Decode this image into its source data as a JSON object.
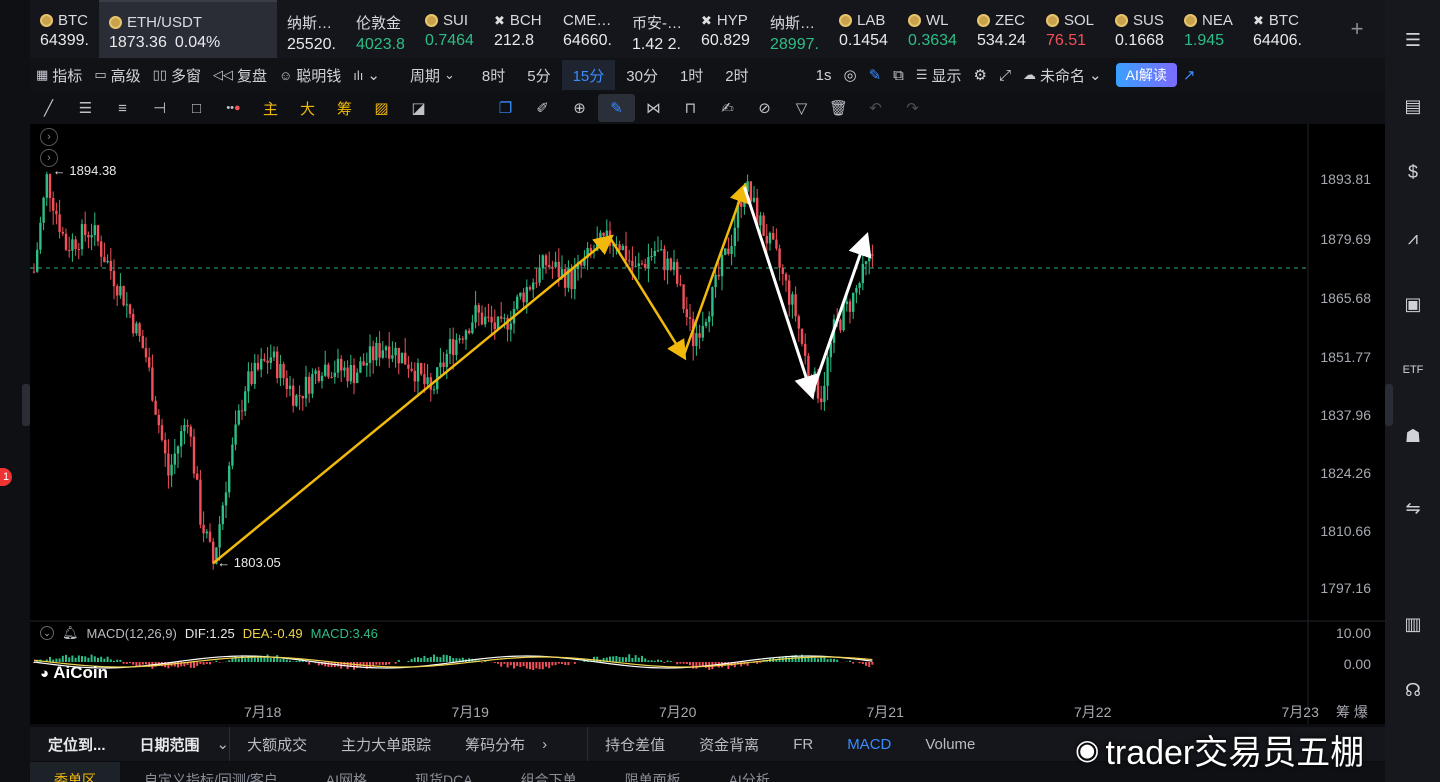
{
  "tickers": [
    {
      "name": "BTC",
      "price": "64399.",
      "icon": "coin",
      "trend": ""
    },
    {
      "name": "ETH/USDT",
      "price": "1873.36",
      "change": "0.04%",
      "icon": "coin",
      "active": true
    },
    {
      "name": "纳斯…",
      "price": "25520.",
      "icon": "none",
      "trend": ""
    },
    {
      "name": "伦敦金",
      "price": "4023.8",
      "icon": "none",
      "trend": "up"
    },
    {
      "name": "SUI",
      "price": "0.7464",
      "icon": "coin",
      "trend": "up"
    },
    {
      "name": "BCH",
      "price": "212.8",
      "icon": "x",
      "trend": ""
    },
    {
      "name": "CME…",
      "price": "64660.",
      "icon": "none",
      "trend": ""
    },
    {
      "name": "币安-…",
      "price": "1.42 2.",
      "icon": "none",
      "trend": ""
    },
    {
      "name": "HYP",
      "price": "60.829",
      "icon": "x",
      "trend": ""
    },
    {
      "name": "纳斯…",
      "price": "28997.",
      "icon": "none",
      "trend": "up"
    },
    {
      "name": "LAB",
      "price": "0.1454",
      "icon": "coin",
      "trend": ""
    },
    {
      "name": "WL",
      "price": "0.3634",
      "icon": "coin",
      "trend": "up"
    },
    {
      "name": "ZEC",
      "price": "534.24",
      "icon": "coin",
      "trend": ""
    },
    {
      "name": "SOL",
      "price": "76.51",
      "icon": "coin",
      "trend": "dn"
    },
    {
      "name": "SUS",
      "price": "0.1668",
      "icon": "coin",
      "trend": ""
    },
    {
      "name": "NEA",
      "price": "1.945",
      "icon": "coin",
      "trend": "up"
    },
    {
      "name": "BTC",
      "price": "64406.",
      "icon": "x",
      "trend": ""
    }
  ],
  "toolbar": {
    "indicator": "指标",
    "advanced": "高级",
    "multi": "多窗",
    "replay": "复盘",
    "smart": "聪明钱",
    "period": "周期",
    "periods": [
      "8时",
      "5分",
      "15分",
      "30分",
      "1时",
      "2时"
    ],
    "selected_period": "15分",
    "interval": "1s",
    "display": "显示",
    "unnamed": "未命名",
    "ai": "AI解读"
  },
  "drawtools": {
    "main": "主",
    "big": "大",
    "chip": "筹"
  },
  "chart_data": {
    "type": "candlestick",
    "symbol": "ETH/USDT",
    "x_ticks": [
      "7月18",
      "7月19",
      "7月20",
      "7月21",
      "7月22",
      "7月23"
    ],
    "y_ticks": [
      1893.81,
      1879.69,
      1865.68,
      1851.77,
      1837.96,
      1824.26,
      1810.66,
      1797.16
    ],
    "ylim": [
      1791,
      1905
    ],
    "last_price": 1876.5,
    "high_marker": "1894.38",
    "low_marker": "1803.05",
    "price_path": [
      [
        0,
        1872
      ],
      [
        4,
        1894
      ],
      [
        10,
        1878
      ],
      [
        18,
        1882
      ],
      [
        28,
        1866
      ],
      [
        35,
        1852
      ],
      [
        42,
        1824
      ],
      [
        48,
        1838
      ],
      [
        52,
        1814
      ],
      [
        56,
        1803
      ],
      [
        60,
        1822
      ],
      [
        66,
        1845
      ],
      [
        74,
        1852
      ],
      [
        82,
        1842
      ],
      [
        90,
        1850
      ],
      [
        100,
        1848
      ],
      [
        110,
        1855
      ],
      [
        118,
        1850
      ],
      [
        124,
        1843
      ],
      [
        130,
        1854
      ],
      [
        138,
        1862
      ],
      [
        146,
        1858
      ],
      [
        152,
        1866
      ],
      [
        160,
        1874
      ],
      [
        168,
        1870
      ],
      [
        176,
        1878
      ],
      [
        182,
        1880
      ],
      [
        188,
        1872
      ],
      [
        194,
        1877
      ],
      [
        200,
        1872
      ],
      [
        206,
        1856
      ],
      [
        212,
        1866
      ],
      [
        218,
        1880
      ],
      [
        222,
        1893
      ],
      [
        226,
        1885
      ],
      [
        232,
        1875
      ],
      [
        238,
        1862
      ],
      [
        242,
        1848
      ],
      [
        246,
        1843
      ],
      [
        250,
        1858
      ],
      [
        256,
        1866
      ],
      [
        262,
        1876
      ]
    ],
    "annotations": [
      {
        "color": "#f0b90b",
        "from": [
          56,
          1803
        ],
        "to": [
          180,
          1880
        ]
      },
      {
        "color": "#f0b90b",
        "from": [
          180,
          1880
        ],
        "to": [
          203,
          1852
        ]
      },
      {
        "color": "#f0b90b",
        "from": [
          203,
          1852
        ],
        "to": [
          222,
          1892
        ]
      },
      {
        "color": "white",
        "from": [
          222,
          1892
        ],
        "to": [
          243,
          1843
        ]
      },
      {
        "color": "white",
        "from": [
          243,
          1843
        ],
        "to": [
          260,
          1880
        ]
      }
    ],
    "macd": {
      "params": "MACD(12,26,9)",
      "dif": "DIF:1.25",
      "dea": "DEA:-0.49",
      "macd": "MACD:3.46",
      "y_ticks": [
        "10.00",
        "0.00"
      ]
    }
  },
  "bottom": {
    "items": [
      "定位到...",
      "日期范围",
      "大额成交",
      "主力大单跟踪",
      "筹码分布",
      "持仓差值",
      "资金背离",
      "FR",
      "MACD",
      "Volume"
    ]
  },
  "bottom2": [
    "委单区",
    "自定义指标/回测/客户",
    "AI网格",
    "现货DCA",
    "组合下单",
    "限单面板",
    "AI分析"
  ],
  "brand": "AiCoin",
  "watermark": "trader交易员五棚",
  "notification_count": "1"
}
